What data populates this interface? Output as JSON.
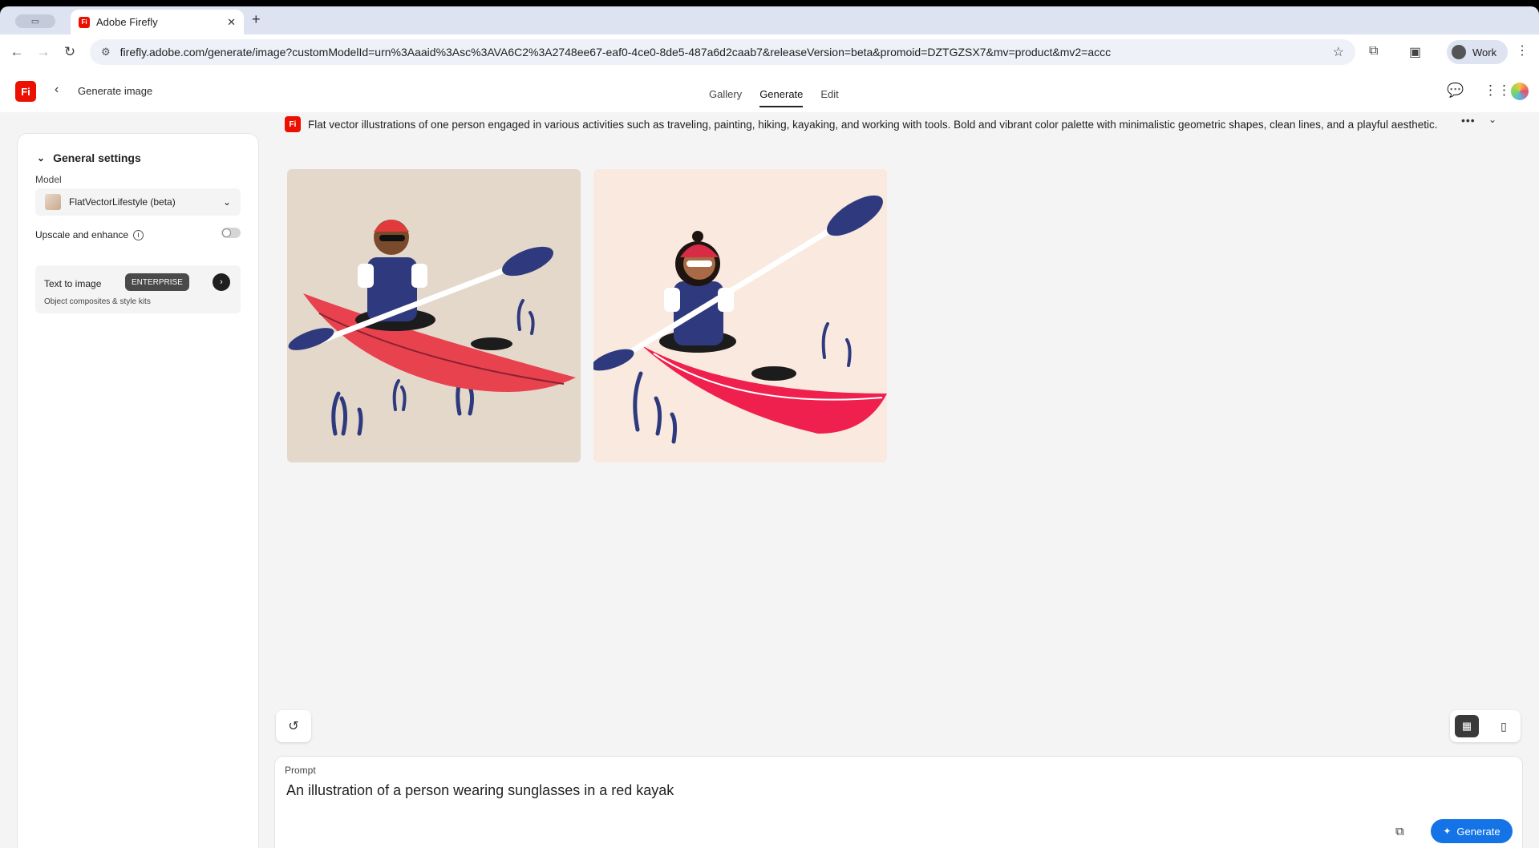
{
  "browser": {
    "tab_title": "Adobe Firefly",
    "favicon_text": "Fi",
    "url": "firefly.adobe.com/generate/image?customModelId=urn%3Aaaid%3Asc%3AVA6C2%3A2748ee67-eaf0-4ce0-8de5-487a6d2caab7&releaseVersion=beta&promoid=DZTGZSX7&mv=product&mv2=accc",
    "profile_label": "Work"
  },
  "header": {
    "logo_text": "Fi",
    "title": "Generate image",
    "tabs": [
      {
        "label": "Gallery",
        "active": false
      },
      {
        "label": "Generate",
        "active": true
      },
      {
        "label": "Edit",
        "active": false
      }
    ]
  },
  "settings": {
    "section_title": "General settings",
    "model_label": "Model",
    "model_value": "FlatVectorLifestyle (beta)",
    "upscale_label": "Upscale and enhance",
    "upscale_on": false,
    "text_to_image": {
      "title": "Text to image",
      "badge": "ENTERPRISE",
      "subtitle": "Object composites & style kits"
    }
  },
  "main": {
    "model_prompt": "Flat vector illustrations of one person engaged in various activities such as traveling, painting, hiking, kayaking, and working with tools. Bold and vibrant color palette with minimalistic geometric shapes, clean lines, and a playful aesthetic.",
    "images": [
      {
        "bg": "#e4d8cb",
        "kayak": "#e8424f",
        "hat": "#e23a3a"
      },
      {
        "bg": "#f9e9df",
        "kayak": "#f0204e",
        "hat": "#d72c45"
      }
    ]
  },
  "prompt": {
    "label": "Prompt",
    "text": "An illustration of a person wearing sunglasses in a red kayak",
    "generate_label": "Generate"
  },
  "colors": {
    "accent": "#1473e6",
    "brand": "#eb1000"
  }
}
